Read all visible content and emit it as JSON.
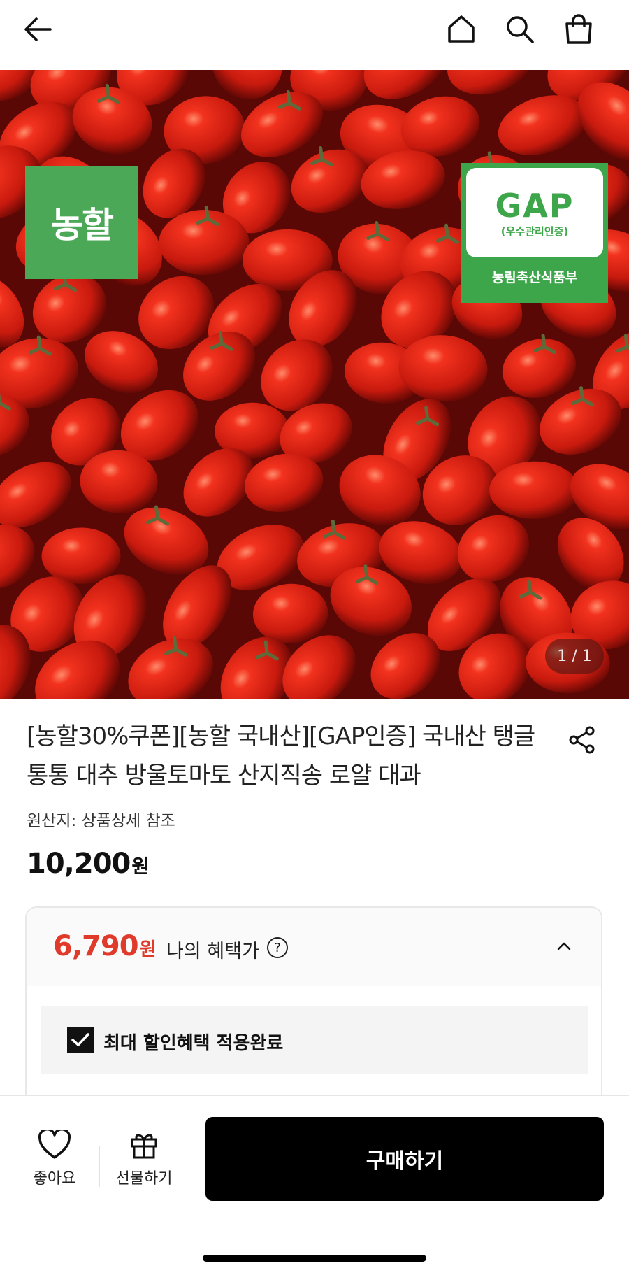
{
  "header": {
    "back_icon": "arrow-left-icon",
    "home_icon": "home-icon",
    "search_icon": "search-icon",
    "cart_icon": "shopping-bag-icon"
  },
  "hero": {
    "badge_left": "농할",
    "gap_title": "GAP",
    "gap_subtitle": "(우수관리인증)",
    "gap_ministry": "농림축산식품부",
    "counter": "1 / 1",
    "brand_green": "#4aa857",
    "tomato_red": "#d82415"
  },
  "product": {
    "title": "[농할30%쿠폰][농할 국내산][GAP인증] 국내산 탱글통통 대추 방울토마토 산지직송 로얄 대과",
    "origin": "원산지: 상품상세 참조",
    "price": "10,200",
    "price_unit": "원",
    "share_icon": "share-icon"
  },
  "benefit": {
    "price": "6,790",
    "price_unit": "원",
    "label": "나의 혜택가",
    "help": "?",
    "price_color": "#e03a2b",
    "applied_label": "최대 할인혜택 적용완료",
    "applied_checked": true
  },
  "bottom": {
    "like_label": "좋아요",
    "gift_label": "선물하기",
    "buy_label": "구매하기"
  }
}
